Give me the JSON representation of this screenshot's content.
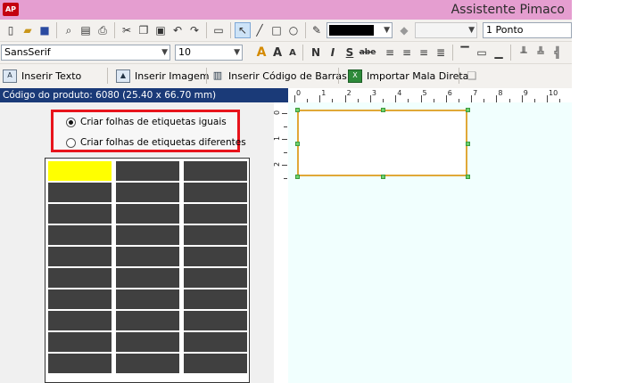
{
  "window": {
    "app_logo": "AP",
    "title": "Assistente Pimaco"
  },
  "toolbar1": {
    "icons": [
      "new-file-icon",
      "open-folder-icon",
      "save-icon",
      "print-preview-icon",
      "print-setup-icon",
      "print-icon",
      "cut-icon",
      "copy-icon",
      "paste-icon",
      "undo-icon",
      "redo-icon",
      "page-icon",
      "pointer-icon",
      "line-icon",
      "rectangle-icon",
      "ellipse-icon",
      "pen-color-icon",
      "fill-icon"
    ],
    "line_color": "#000000",
    "line_width": "1 Ponto"
  },
  "toolbar2": {
    "font_family": "SansSerif",
    "font_size": "10",
    "format_buttons": [
      "A",
      "A",
      "A",
      "N",
      "I",
      "S",
      "abe"
    ]
  },
  "toolbar3": {
    "insert_text": "Inserir Texto",
    "insert_image": "Inserir Imagem",
    "insert_barcode": "Inserir Código de Barras",
    "import_mail_merge": "Importar Mala Direta"
  },
  "status": {
    "product_code": "Código do produto: 6080 (25.40 x 66.70 mm)"
  },
  "options": {
    "equal_sheets": "Criar folhas de etiquetas iguais",
    "different_sheets": "Criar folhas de etiquetas diferentes",
    "selected": "equal_sheets"
  },
  "sheet": {
    "rows": 10,
    "cols": 3,
    "selected_index": 0
  },
  "ruler": {
    "top_labels": [
      "0",
      "1",
      "2",
      "3",
      "4",
      "5",
      "6",
      "7",
      "8",
      "9",
      "10"
    ],
    "left_labels": [
      "0",
      "1",
      "2"
    ]
  },
  "colors": {
    "title_bar": "#e59ed0",
    "status_bar": "#1a3a78",
    "highlight_box": "#e8141c",
    "selected_label": "#ffff00"
  }
}
